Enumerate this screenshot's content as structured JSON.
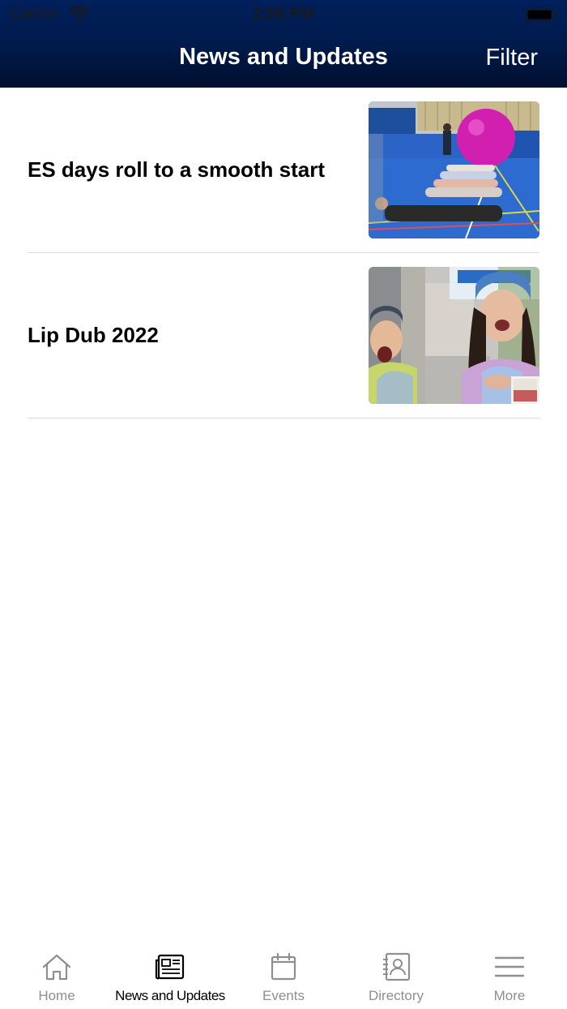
{
  "status_bar": {
    "carrier": "Carrier",
    "time": "2:56 PM"
  },
  "nav": {
    "title": "News and Updates",
    "filter_label": "Filter"
  },
  "news": [
    {
      "title": "ES days roll to a smooth start",
      "image": "gym-kids-with-pink-ball-thumbnail"
    },
    {
      "title": "Lip Dub 2022",
      "image": "two-girls-singing-hallway-thumbnail"
    }
  ],
  "tabs": [
    {
      "label": "Home",
      "icon": "home-icon"
    },
    {
      "label": "News and Updates",
      "icon": "newspaper-icon",
      "active": true
    },
    {
      "label": "Events",
      "icon": "calendar-icon"
    },
    {
      "label": "Directory",
      "icon": "contact-book-icon"
    },
    {
      "label": "More",
      "icon": "menu-icon"
    }
  ],
  "colors": {
    "header": "#00205c",
    "tab_inactive": "#8e8e93",
    "tab_active": "#000000",
    "divider": "#d9d9d9"
  }
}
